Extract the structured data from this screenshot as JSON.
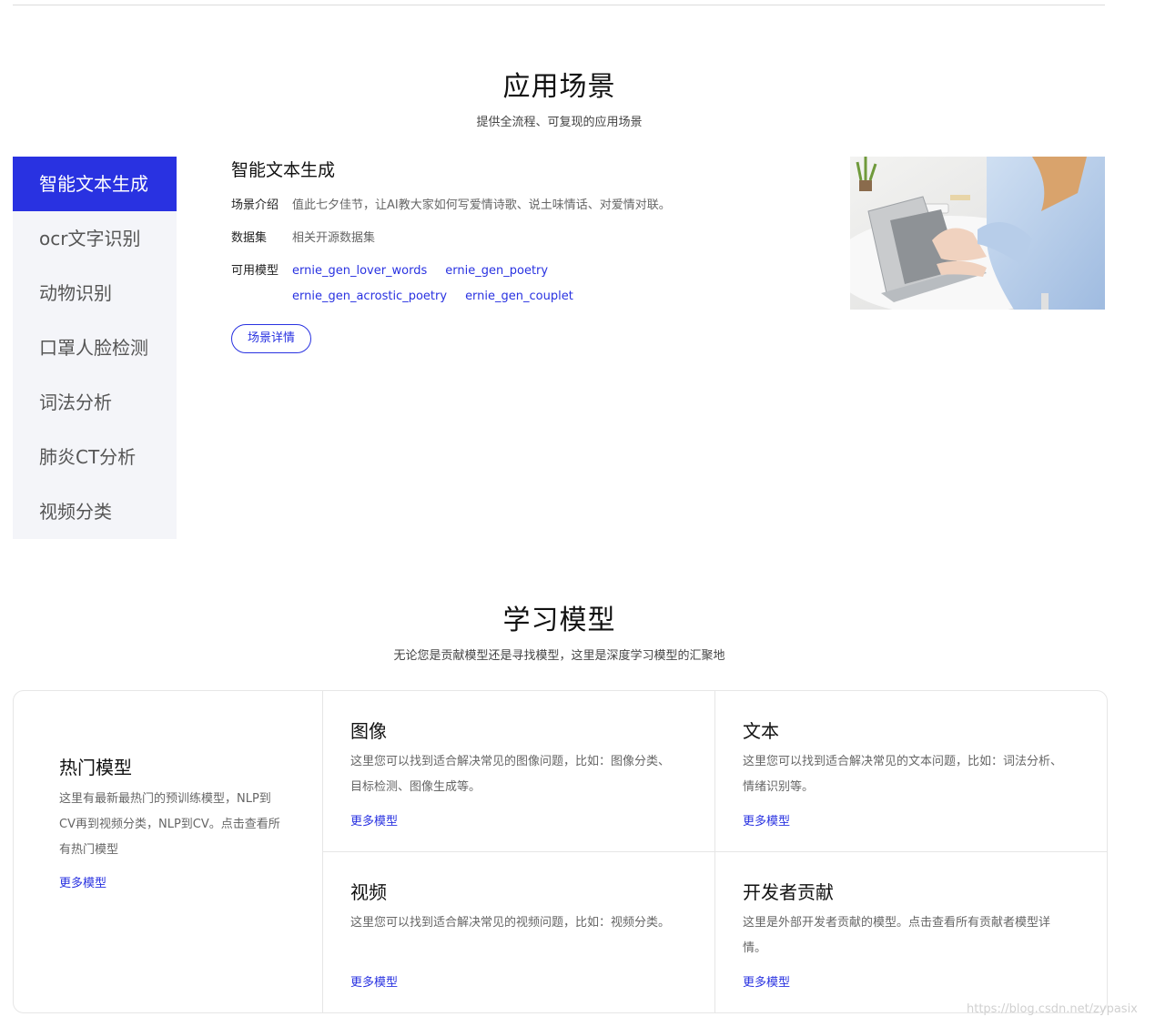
{
  "scenes": {
    "title": "应用场景",
    "subtitle": "提供全流程、可复现的应用场景",
    "tabs": [
      {
        "label": "智能文本生成"
      },
      {
        "label": "ocr文字识别"
      },
      {
        "label": "动物识别"
      },
      {
        "label": "口罩人脸检测"
      },
      {
        "label": "词法分析"
      },
      {
        "label": "肺炎CT分析"
      },
      {
        "label": "视频分类"
      }
    ],
    "active_tab": "智能文本生成",
    "detail": {
      "title": "智能文本生成",
      "intro_label": "场景介绍",
      "intro_value": "值此七夕佳节，让AI教大家如何写爱情诗歌、说土味情话、对爱情对联。",
      "dataset_label": "数据集",
      "dataset_value": "相关开源数据集",
      "models_label": "可用模型",
      "models": [
        "ernie_gen_lover_words",
        "ernie_gen_poetry",
        "ernie_gen_acrostic_poetry",
        "ernie_gen_couplet"
      ],
      "button_label": "场景详情"
    }
  },
  "models": {
    "title": "学习模型",
    "subtitle": "无论您是贡献模型还是寻找模型，这里是深度学习模型的汇聚地",
    "hot": {
      "title": "热门模型",
      "desc": "这里有最新最热门的预训练模型，NLP到CV再到视频分类，NLP到CV。点击查看所有热门模型",
      "more": "更多模型"
    },
    "categories": [
      {
        "title": "图像",
        "desc": "这里您可以找到适合解决常见的图像问题，比如：图像分类、目标检测、图像生成等。",
        "more": "更多模型"
      },
      {
        "title": "文本",
        "desc": "这里您可以找到适合解决常见的文本问题，比如：词法分析、情绪识别等。",
        "more": "更多模型"
      },
      {
        "title": "视频",
        "desc": "这里您可以找到适合解决常见的视频问题，比如：视频分类。",
        "more": "更多模型"
      },
      {
        "title": "开发者贡献",
        "desc": "这里是外部开发者贡献的模型。点击查看所有贡献者模型详情。",
        "more": "更多模型"
      }
    ]
  },
  "watermark": "https://blog.csdn.net/zypasix",
  "colors": {
    "accent": "#2932e1",
    "sidebar_bg": "#f4f5f9",
    "border": "#e6e6e6"
  }
}
